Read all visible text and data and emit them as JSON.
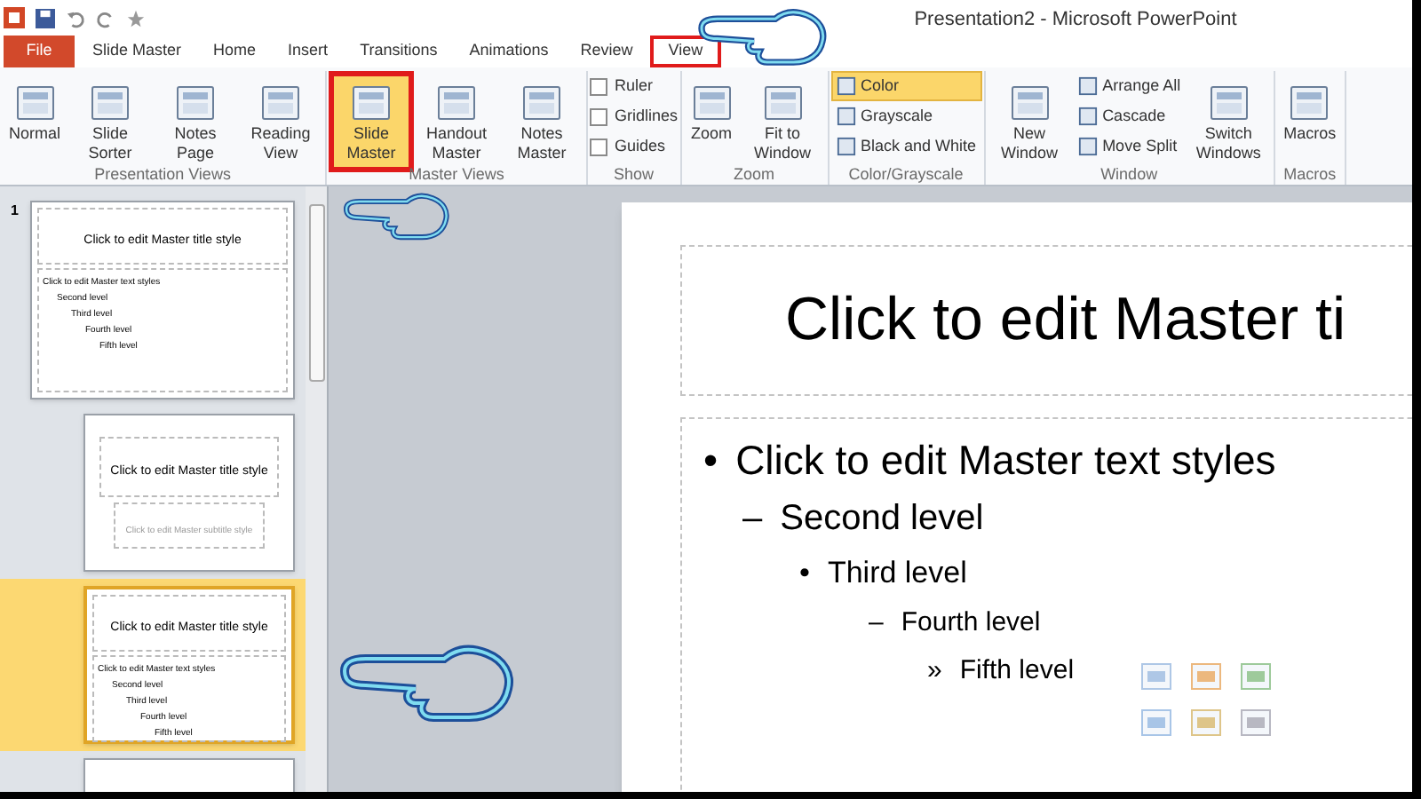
{
  "window": {
    "title": "Presentation2 - Microsoft PowerPoint"
  },
  "tabs": [
    {
      "label": "File",
      "kind": "file",
      "selected": false
    },
    {
      "label": "Slide Master",
      "kind": "tab",
      "selected": false
    },
    {
      "label": "Home",
      "kind": "tab",
      "selected": false
    },
    {
      "label": "Insert",
      "kind": "tab",
      "selected": false
    },
    {
      "label": "Transitions",
      "kind": "tab",
      "selected": false
    },
    {
      "label": "Animations",
      "kind": "tab",
      "selected": false
    },
    {
      "label": "Review",
      "kind": "tab",
      "selected": false
    },
    {
      "label": "View",
      "kind": "tab",
      "selected": true
    }
  ],
  "ribbon": [
    {
      "label": "Presentation Views",
      "items": [
        {
          "kind": "large",
          "label": "Normal",
          "selected": false
        },
        {
          "kind": "large",
          "label": "Slide Sorter",
          "selected": false
        },
        {
          "kind": "large",
          "label": "Notes Page",
          "selected": false
        },
        {
          "kind": "large",
          "label": "Reading View",
          "selected": false
        }
      ]
    },
    {
      "label": "Master Views",
      "items": [
        {
          "kind": "large",
          "label": "Slide Master",
          "selected": true
        },
        {
          "kind": "large",
          "label": "Handout Master",
          "selected": false
        },
        {
          "kind": "large",
          "label": "Notes Master",
          "selected": false
        }
      ]
    },
    {
      "label": "Show",
      "items": [
        {
          "kind": "check",
          "label": "Ruler",
          "checked": false
        },
        {
          "kind": "check",
          "label": "Gridlines",
          "checked": false
        },
        {
          "kind": "check",
          "label": "Guides",
          "checked": false
        }
      ]
    },
    {
      "label": "Zoom",
      "items": [
        {
          "kind": "large",
          "label": "Zoom",
          "selected": false
        },
        {
          "kind": "large",
          "label": "Fit to Window",
          "selected": false
        }
      ]
    },
    {
      "label": "Color/Grayscale",
      "items": [
        {
          "kind": "small",
          "label": "Color",
          "selected": true
        },
        {
          "kind": "small",
          "label": "Grayscale",
          "selected": false
        },
        {
          "kind": "small",
          "label": "Black and White",
          "selected": false
        }
      ]
    },
    {
      "label": "Window",
      "items": [
        {
          "kind": "large",
          "label": "New Window",
          "selected": false
        },
        {
          "kind": "small",
          "label": "Arrange All",
          "selected": false
        },
        {
          "kind": "small",
          "label": "Cascade",
          "selected": false
        },
        {
          "kind": "small",
          "label": "Move Split",
          "selected": false
        },
        {
          "kind": "large",
          "label": "Switch Windows",
          "selected": false
        }
      ]
    },
    {
      "label": "Macros",
      "items": [
        {
          "kind": "large",
          "label": "Macros",
          "selected": false
        }
      ]
    }
  ],
  "thumbnails": [
    {
      "number": "1",
      "kind": "content",
      "selected": false,
      "title": "Click to edit Master title style",
      "lines": [
        "Click to edit Master text styles",
        "Second level",
        "Third level",
        "Fourth level",
        "Fifth level"
      ]
    },
    {
      "kind": "title",
      "selected": false,
      "title": "Click to edit Master title style",
      "subtitle": "Click to edit Master subtitle style"
    },
    {
      "kind": "content",
      "selected": true,
      "title": "Click to edit Master title style",
      "lines": [
        "Click to edit Master text styles",
        "Second level",
        "Third level",
        "Fourth level",
        "Fifth level"
      ]
    },
    {
      "kind": "blank",
      "selected": false
    }
  ],
  "slide": {
    "title": "Click to edit Master ti",
    "bullets": [
      {
        "marker": "•",
        "text": "Click to edit Master text styles"
      },
      {
        "marker": "–",
        "text": "Second level"
      },
      {
        "marker": "•",
        "text": "Third level"
      },
      {
        "marker": "–",
        "text": "Fourth level"
      },
      {
        "marker": "»",
        "text": "Fifth level"
      }
    ]
  }
}
